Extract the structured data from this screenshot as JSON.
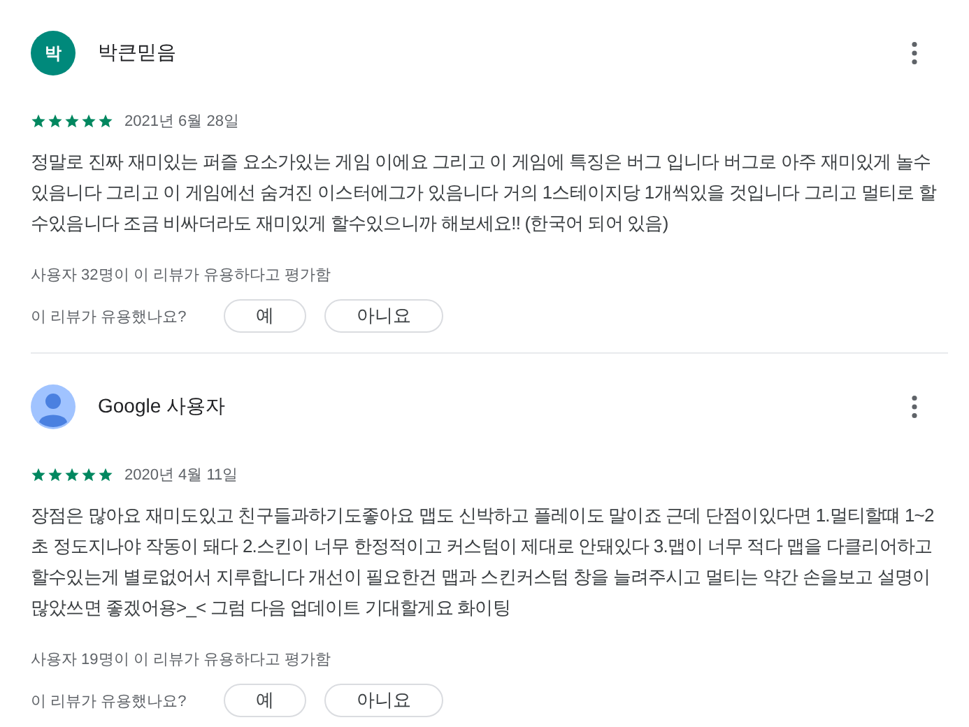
{
  "reviews": [
    {
      "author": "박큰믿음",
      "avatar": {
        "kind": "letter",
        "letter": "박",
        "color": "#00897b"
      },
      "stars": 5,
      "date": "2021년 6월 28일",
      "text": "정말로 진짜 재미있는 퍼즐 요소가있는 게임 이에요 그리고 이 게임에 특징은 버그 입니다 버그로 아주 재미있게 놀수있음니다 그리고 이 게임에선 숨겨진 이스터에그가 있음니다 거의 1스테이지당 1개씩있을 것입니다 그리고 멀티로 할수있음니다 조금 비싸더라도 재미있게 할수있으니까 해보세요!! (한국어 되어 있음)",
      "helpful_count": "사용자 32명이 이 리뷰가 유용하다고 평가함",
      "helpful_question": "이 리뷰가 유용했나요?",
      "buttons": [
        "예",
        "아니요"
      ]
    },
    {
      "author": "Google 사용자",
      "avatar": {
        "kind": "silhouette",
        "color": "#a0c3ff"
      },
      "stars": 5,
      "date": "2020년 4월 11일",
      "text": "장점은 많아요 재미도있고 친구들과하기도좋아요 맵도 신박하고 플레이도 말이죠 근데 단점이있다면 1.멀티할떄 1~2초 정도지나야 작동이 돼다 2.스킨이 너무 한정적이고 커스텀이 제대로 안돼있다 3.맵이 너무 적다 맵을 다클리어하고 할수있는게 별로없어서 지루합니다 개선이 필요한건 맵과 스킨커스텀 창을 늘려주시고 멀티는 약간 손을보고 설명이 많았쓰면 좋겠어용>_< 그럼 다음 업데이트 기대할게요 화이팅",
      "helpful_count": "사용자 19명이 이 리뷰가 유용하다고 평가함",
      "helpful_question": "이 리뷰가 유용했나요?",
      "buttons": [
        "예",
        "아니요"
      ]
    }
  ]
}
